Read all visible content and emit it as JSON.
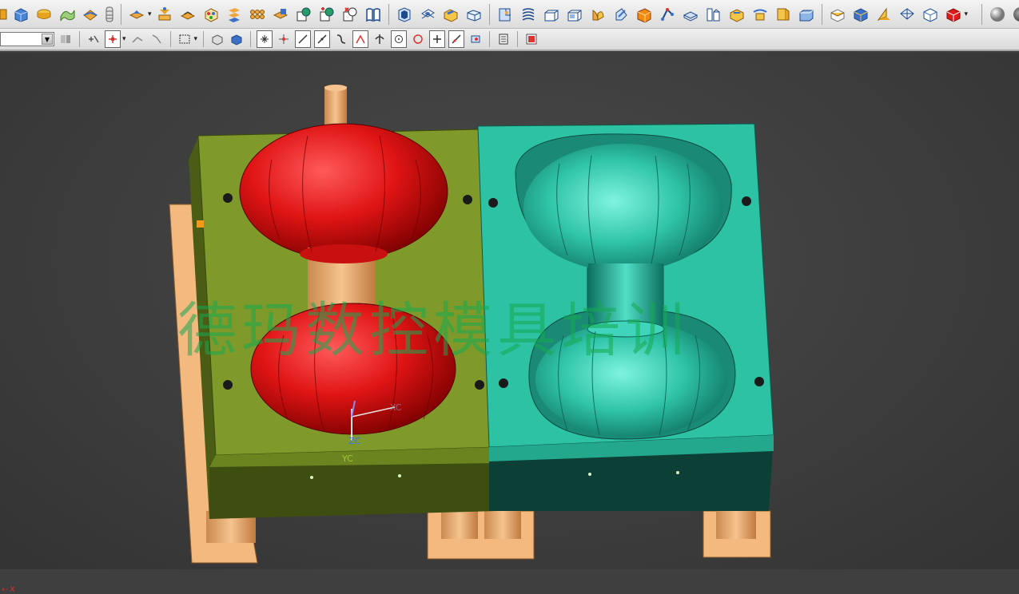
{
  "toolbar_top": {
    "icons": [
      "feature-icon",
      "block-icon",
      "cylinder-icon",
      "surface-icon",
      "sew-icon",
      "tube-icon",
      "extrude-icon",
      "revolve-icon",
      "pattern-icon",
      "mirror-icon",
      "array-icon",
      "offset-icon",
      "trim-icon",
      "unite-icon",
      "subtract-icon",
      "book-icon",
      "doorway-icon",
      "shell-icon",
      "hole-icon",
      "slot-icon",
      "boss-icon",
      "pocket-icon",
      "pad-icon",
      "groove-icon",
      "draft-icon",
      "edge-blend-icon",
      "chamfer-icon",
      "thicken-icon",
      "scale-icon",
      "wrap-icon",
      "split-icon",
      "sphere-icon",
      "box-icon",
      "wedge-icon",
      "patch-icon",
      "shaded-icon",
      "wireframe-icon",
      "render-icon",
      "material-icon"
    ]
  },
  "toolbar_bottom": {
    "filter_value": "",
    "icons": [
      "snap-icon",
      "point-icon",
      "select-box-icon",
      "curve-icon",
      "face-icon",
      "body-icon",
      "endpoint-icon",
      "midpoint-icon",
      "line-icon",
      "arc-icon",
      "quadrant-icon",
      "center-icon",
      "intersection-icon",
      "tangent-icon",
      "color-icon",
      "layer-icon",
      "stop-icon"
    ]
  },
  "viewport": {
    "watermark": "德玛数控模具培训",
    "axis_labels": {
      "x": "X",
      "zc": "ZC",
      "yc": "YC",
      "xc": "XC"
    }
  },
  "colors": {
    "core_plate": "#7f9a2a",
    "cavity_plate": "#2ec2a5",
    "part": "#d11212",
    "base": "#f3b97f"
  }
}
